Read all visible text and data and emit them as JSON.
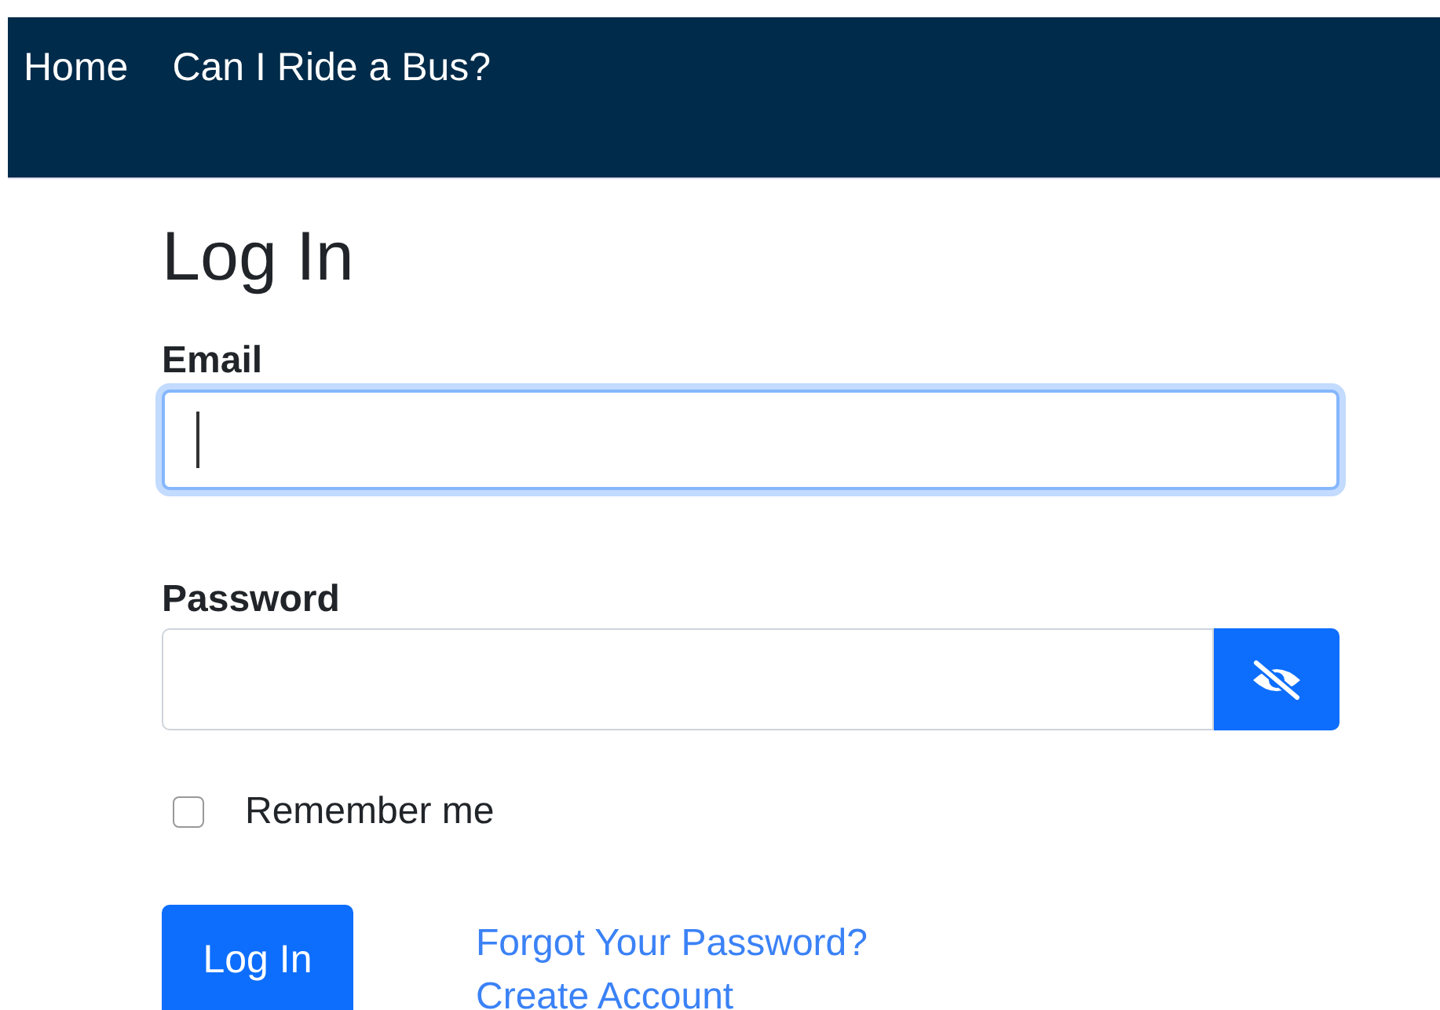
{
  "nav": {
    "links": [
      {
        "label": "Home"
      },
      {
        "label": "Can I Ride a Bus?"
      }
    ]
  },
  "title": "Log In",
  "email": {
    "label": "Email",
    "focused": true
  },
  "password": {
    "label": "Password",
    "revealed": false
  },
  "remember": {
    "label": "Remember me",
    "checked": false
  },
  "submit": "Log In",
  "links": [
    {
      "label": "Forgot Your Password?"
    },
    {
      "label": "Create Account"
    }
  ]
}
